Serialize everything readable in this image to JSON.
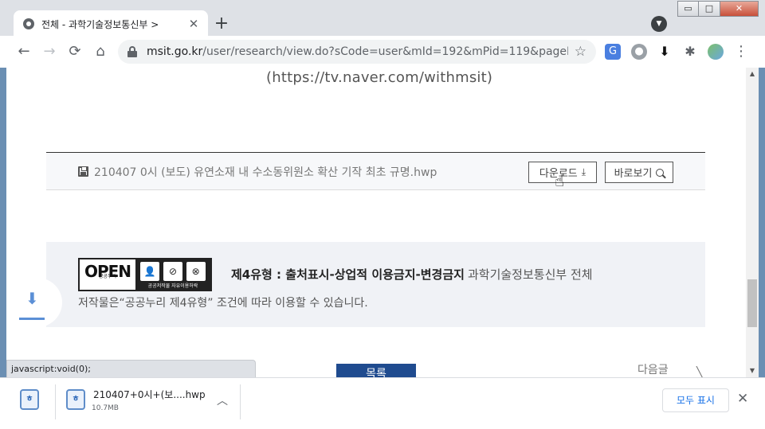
{
  "tab": {
    "title": "전체 - 과학기술정보통신부 >",
    "close": "✕"
  },
  "new_tab": "+",
  "window_controls": {
    "minimize": "▭",
    "maximize": "□",
    "close": "✕"
  },
  "toolbar": {
    "back": "←",
    "forward": "→",
    "reload": "⟳",
    "home": "⌂",
    "url_host": "msit.go.kr",
    "url_path": "/user/research/view.do?sCode=user&mId=192&mPid=119&pageIndex...",
    "bookmark": "☆",
    "menu": "⋮"
  },
  "page": {
    "tv_link": "(https://tv.naver.com/withmsit)",
    "attachment": {
      "file_name": "210407 0시 (보도) 유연소재 내 수소동위원소 확산 기작 최초 규명.hwp",
      "download_label": "다운로드",
      "preview_label": "바로보기"
    },
    "license": {
      "logo_text": "OPEN",
      "logo_sub": "공공누리",
      "logo_boxes_sub": "공공저작물 자유이용허락",
      "title": "제4유형 : 출처표시-상업적 이용금지-변경금지",
      "org": "과학기술정보통신부 전체",
      "description": "저작물은“공공누리 제4유형” 조건에 따라 이용할 수 있습니다."
    },
    "list_button": "목록",
    "next_label": "다음글"
  },
  "status_bar": "javascript:void(0);",
  "download_shelf": {
    "item_name": "210407+0시+(보....hwp",
    "item_size": "10.7MB",
    "show_all": "모두 표시",
    "close": "✕"
  },
  "colors": {
    "accent": "#1a73e8",
    "list_button": "#1f4b8f",
    "floating_download": "#5b8fd6"
  }
}
